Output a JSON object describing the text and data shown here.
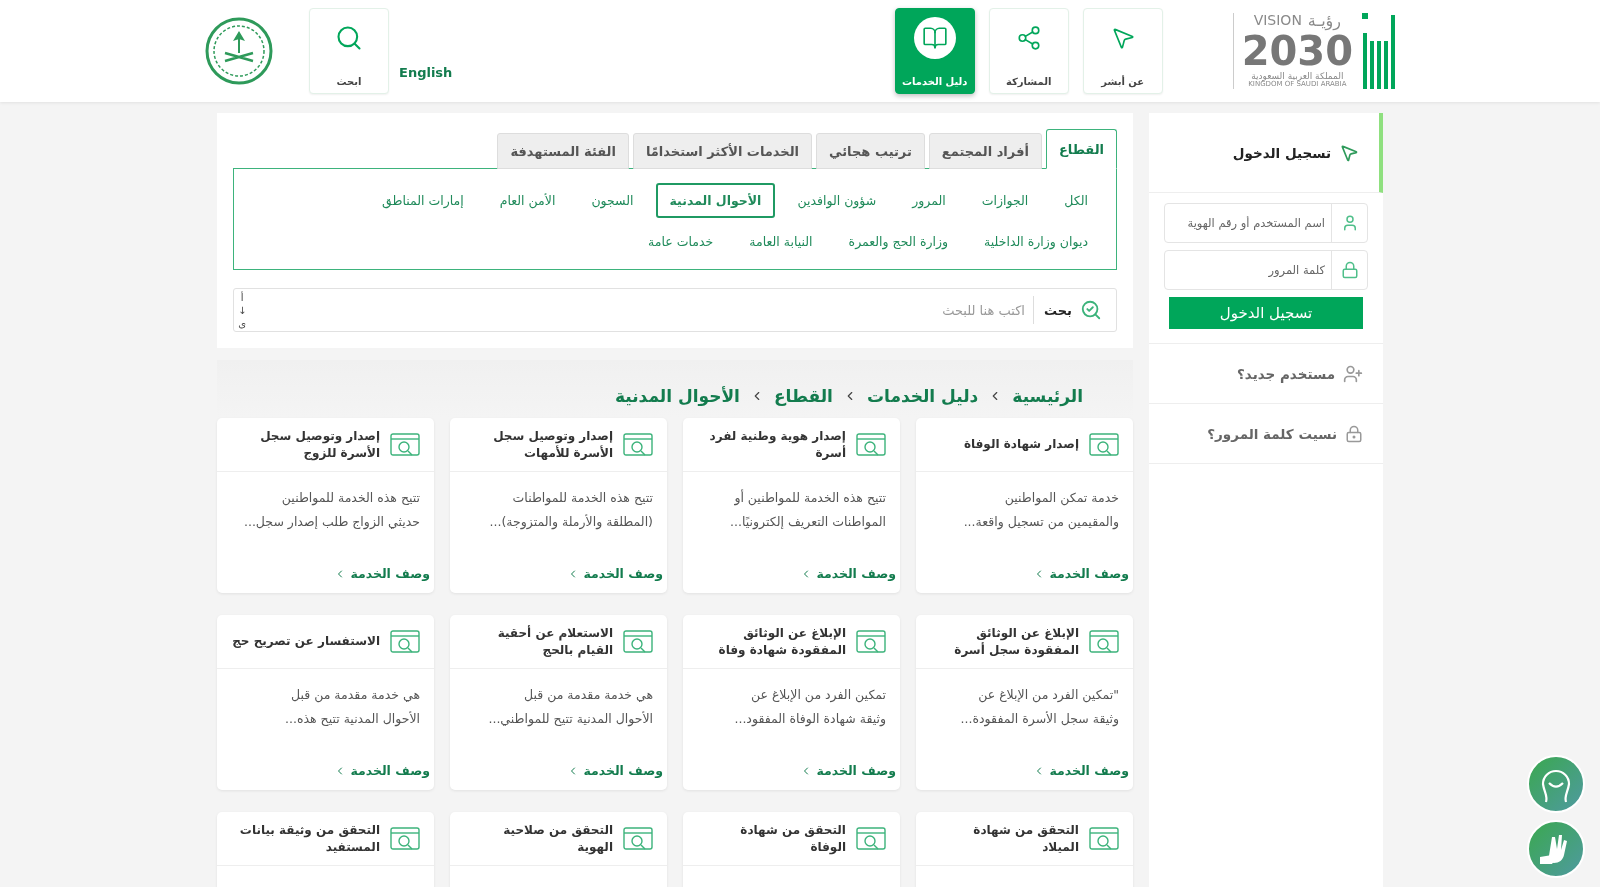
{
  "header": {
    "vision_logo": {
      "word_ar": "رؤيـة",
      "word_en": "VISION",
      "year": "2030",
      "country_ar": "المملكة العربية السعودية",
      "country_en": "KINGDOM OF SAUDI ARABIA"
    },
    "nav": [
      {
        "kind": "about",
        "label": "عن أبشر",
        "selected": false
      },
      {
        "kind": "share",
        "label": "المشاركة",
        "selected": false
      },
      {
        "kind": "guide",
        "label": "دليل الخدمات",
        "selected": true
      }
    ],
    "language": "English",
    "search_button": "ابحث"
  },
  "tabs": [
    {
      "label": "القطاع",
      "selected": true
    },
    {
      "label": "أفراد المجتمع",
      "selected": false
    },
    {
      "label": "ترتيب هجائي",
      "selected": false
    },
    {
      "label": "الخدمات الأكثر استخدامًا",
      "selected": false
    },
    {
      "label": "الفئة المستهدفة",
      "selected": false
    }
  ],
  "categories": [
    {
      "label": "الكل",
      "selected": false
    },
    {
      "label": "الجوازات",
      "selected": false
    },
    {
      "label": "المرور",
      "selected": false
    },
    {
      "label": "شؤون الوافدين",
      "selected": false
    },
    {
      "label": "الأحوال المدنية",
      "selected": true
    },
    {
      "label": "السجون",
      "selected": false
    },
    {
      "label": "الأمن العام",
      "selected": false
    },
    {
      "label": "إمارات المناطق",
      "selected": false
    },
    {
      "label": "ديوان وزارة الداخلية",
      "selected": false
    },
    {
      "label": "وزارة الحج والعمرة",
      "selected": false
    },
    {
      "label": "النيابة العامة",
      "selected": false
    },
    {
      "label": "خدمات عامة",
      "selected": false
    }
  ],
  "search": {
    "button": "بحث",
    "placeholder": "اكتب هنا للبحث",
    "sort": [
      "أ",
      "↓",
      "ى"
    ]
  },
  "breadcrumb": [
    "الرئيسية",
    "دليل الخدمات",
    "القطاع",
    "الأحوال المدنية"
  ],
  "services": [
    {
      "title": "إصدار شهادة الوفاة",
      "description": "خدمة تمكن المواطنين\nوالمقيمين من تسجيل واقعة...",
      "link": "وصف الخدمة"
    },
    {
      "title": "إصدار هوية وطنية لفرد\nأسرة",
      "description": "تتيح هذه الخدمة للمواطنين أو\nالمواطنات التعريف إلكترونيًا...",
      "link": "وصف الخدمة"
    },
    {
      "title": "إصدار وتوصيل سجل\nالأسرة للأمهات",
      "description": "تتيح هذه الخدمة للمواطنات\n(المطلقة والأرملة والمتزوجة)...",
      "link": "وصف الخدمة"
    },
    {
      "title": "إصدار وتوصيل سجل\nالأسرة للزوج",
      "description": "تتيح هذه الخدمة للمواطنين\nحديثي الزواج طلب إصدار سجل...",
      "link": "وصف الخدمة"
    },
    {
      "title": "الإبلاغ عن الوثائق\nالمفقودة سجل أسرة",
      "description": "\"تمكين الفرد من الإبلاغ عن\nوثيقة سجل الأسرة المفقودة...",
      "link": "وصف الخدمة"
    },
    {
      "title": "الإبلاغ عن الوثائق\nالمفقودة شهادة وفاة",
      "description": "تمكين الفرد من الإبلاغ عن\nوثيقة شهادة الوفاة المفقود...",
      "link": "وصف الخدمة"
    },
    {
      "title": "الاستعلام عن أحقية\nالقيام بالحج",
      "description": "هي خدمة مقدمة من قبل\nالأحوال المدنية تتيح للمواطني...",
      "link": "وصف الخدمة"
    },
    {
      "title": "الاستفسار عن تصريح حج",
      "description": "هي خدمة مقدمة من قبل\nالأحوال المدنية تتيح هذه...",
      "link": "وصف الخدمة"
    },
    {
      "title": "التحقق من شهادة\nالميلاد"
    },
    {
      "title": "التحقق من شهادة\nالوفاة"
    },
    {
      "title": "التحقق من صلاحية\nالهوية"
    },
    {
      "title": "التحقق من وثيقة بيانات\nالمستفيد"
    }
  ],
  "login": {
    "title": "تسجيل الدخول",
    "username_placeholder": "اسم المستخدم أو رقم الهوية",
    "password_placeholder": "كلمة المرور",
    "button": "تسجيل الدخول",
    "new_user": "مستخدم جديد؟",
    "forgot": "نسيت كلمة المرور؟"
  }
}
